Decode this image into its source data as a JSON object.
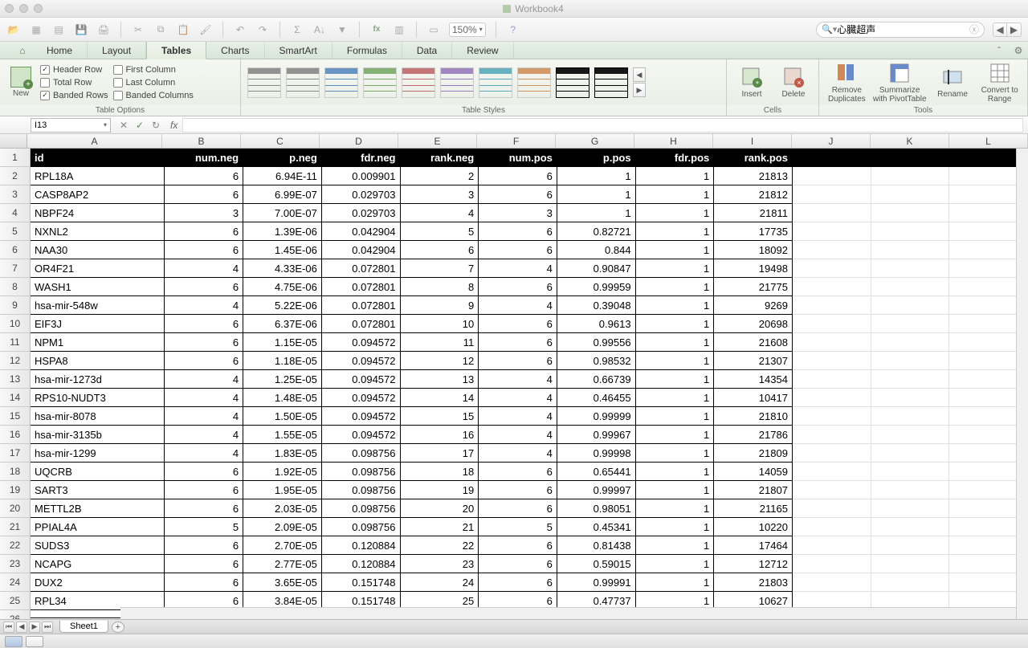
{
  "window": {
    "title": "Workbook4"
  },
  "qat": {
    "zoom": "150%",
    "search_value": "心臓超声"
  },
  "ribbon_tabs": [
    "Home",
    "Layout",
    "Tables",
    "Charts",
    "SmartArt",
    "Formulas",
    "Data",
    "Review"
  ],
  "active_tab": "Tables",
  "ribbon": {
    "table_options_label": "Table Options",
    "new_label": "New",
    "opts": {
      "header_row": "Header Row",
      "total_row": "Total Row",
      "banded_rows": "Banded Rows",
      "first_column": "First Column",
      "last_column": "Last Column",
      "banded_columns": "Banded Columns"
    },
    "table_styles_label": "Table Styles",
    "cells_label": "Cells",
    "insert": "Insert",
    "delete": "Delete",
    "tools_label": "Tools",
    "remove_dup": "Remove Duplicates",
    "pivot": "Summarize with PivotTable",
    "rename": "Rename",
    "convert": "Convert to Range"
  },
  "fx": {
    "namebox": "I13",
    "formula": ""
  },
  "columns": [
    "A",
    "B",
    "C",
    "D",
    "E",
    "F",
    "G",
    "H",
    "I",
    "J",
    "K",
    "L"
  ],
  "headers": [
    "id",
    "num.neg",
    "p.neg",
    "fdr.neg",
    "rank.neg",
    "num.pos",
    "p.pos",
    "fdr.pos",
    "rank.pos"
  ],
  "rows": [
    [
      "RPL18A",
      "6",
      "6.94E-11",
      "0.009901",
      "2",
      "6",
      "1",
      "1",
      "21813"
    ],
    [
      "CASP8AP2",
      "6",
      "6.99E-07",
      "0.029703",
      "3",
      "6",
      "1",
      "1",
      "21812"
    ],
    [
      "NBPF24",
      "3",
      "7.00E-07",
      "0.029703",
      "4",
      "3",
      "1",
      "1",
      "21811"
    ],
    [
      "NXNL2",
      "6",
      "1.39E-06",
      "0.042904",
      "5",
      "6",
      "0.82721",
      "1",
      "17735"
    ],
    [
      "NAA30",
      "6",
      "1.45E-06",
      "0.042904",
      "6",
      "6",
      "0.844",
      "1",
      "18092"
    ],
    [
      "OR4F21",
      "4",
      "4.33E-06",
      "0.072801",
      "7",
      "4",
      "0.90847",
      "1",
      "19498"
    ],
    [
      "WASH1",
      "6",
      "4.75E-06",
      "0.072801",
      "8",
      "6",
      "0.99959",
      "1",
      "21775"
    ],
    [
      "hsa-mir-548w",
      "4",
      "5.22E-06",
      "0.072801",
      "9",
      "4",
      "0.39048",
      "1",
      "9269"
    ],
    [
      "EIF3J",
      "6",
      "6.37E-06",
      "0.072801",
      "10",
      "6",
      "0.9613",
      "1",
      "20698"
    ],
    [
      "NPM1",
      "6",
      "1.15E-05",
      "0.094572",
      "11",
      "6",
      "0.99556",
      "1",
      "21608"
    ],
    [
      "HSPA8",
      "6",
      "1.18E-05",
      "0.094572",
      "12",
      "6",
      "0.98532",
      "1",
      "21307"
    ],
    [
      "hsa-mir-1273d",
      "4",
      "1.25E-05",
      "0.094572",
      "13",
      "4",
      "0.66739",
      "1",
      "14354"
    ],
    [
      "RPS10-NUDT3",
      "4",
      "1.48E-05",
      "0.094572",
      "14",
      "4",
      "0.46455",
      "1",
      "10417"
    ],
    [
      "hsa-mir-8078",
      "4",
      "1.50E-05",
      "0.094572",
      "15",
      "4",
      "0.99999",
      "1",
      "21810"
    ],
    [
      "hsa-mir-3135b",
      "4",
      "1.55E-05",
      "0.094572",
      "16",
      "4",
      "0.99967",
      "1",
      "21786"
    ],
    [
      "hsa-mir-1299",
      "4",
      "1.83E-05",
      "0.098756",
      "17",
      "4",
      "0.99998",
      "1",
      "21809"
    ],
    [
      "UQCRB",
      "6",
      "1.92E-05",
      "0.098756",
      "18",
      "6",
      "0.65441",
      "1",
      "14059"
    ],
    [
      "SART3",
      "6",
      "1.95E-05",
      "0.098756",
      "19",
      "6",
      "0.99997",
      "1",
      "21807"
    ],
    [
      "METTL2B",
      "6",
      "2.03E-05",
      "0.098756",
      "20",
      "6",
      "0.98051",
      "1",
      "21165"
    ],
    [
      "PPIAL4A",
      "5",
      "2.09E-05",
      "0.098756",
      "21",
      "5",
      "0.45341",
      "1",
      "10220"
    ],
    [
      "SUDS3",
      "6",
      "2.70E-05",
      "0.120884",
      "22",
      "6",
      "0.81438",
      "1",
      "17464"
    ],
    [
      "NCAPG",
      "6",
      "2.77E-05",
      "0.120884",
      "23",
      "6",
      "0.59015",
      "1",
      "12712"
    ],
    [
      "DUX2",
      "6",
      "3.65E-05",
      "0.151748",
      "24",
      "6",
      "0.99991",
      "1",
      "21803"
    ],
    [
      "RPL34",
      "6",
      "3.84E-05",
      "0.151748",
      "25",
      "6",
      "0.47737",
      "1",
      "10627"
    ]
  ],
  "sheet_tab": "Sheet1"
}
